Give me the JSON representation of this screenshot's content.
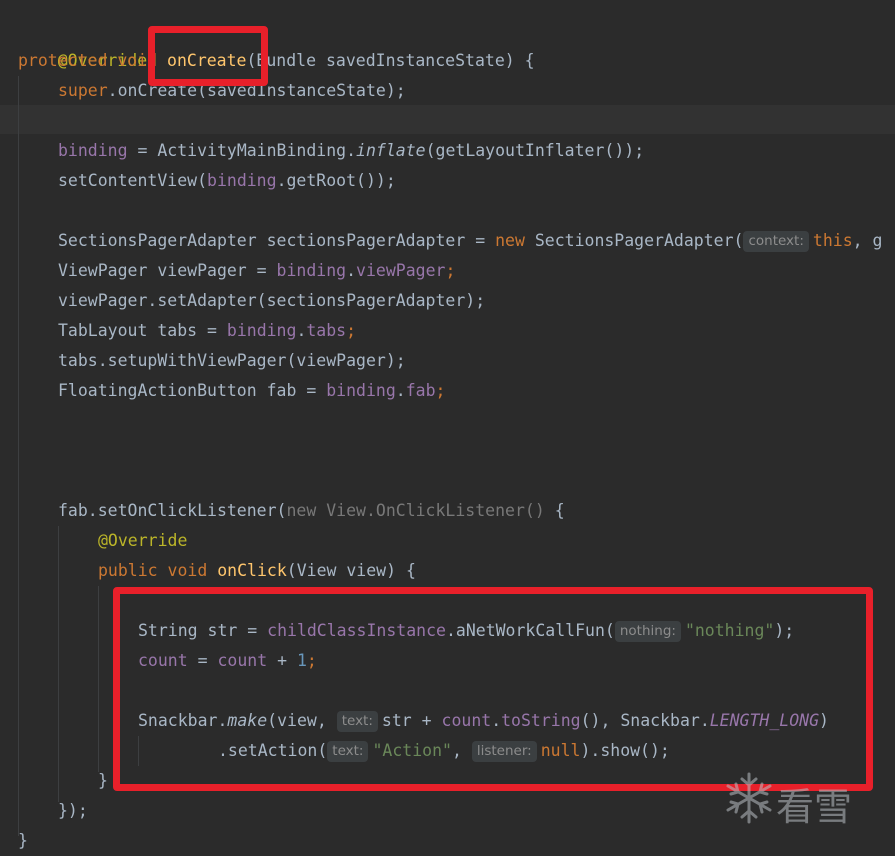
{
  "code": {
    "l1": "@Override",
    "l2_kw": "protected void ",
    "l2_fn": "onCreate",
    "l2_rest": "(Bundle savedInstanceState) {",
    "l3_kw": "super",
    "l3_rest": ".onCreate(savedInstanceState);",
    "l4_fld": "binding",
    "l4_mid": " = ActivityMainBinding.",
    "l4_it": "inflate",
    "l4_rest": "(getLayoutInflater());",
    "l5_a": "setContentView(",
    "l5_fld": "binding",
    "l5_rest": ".getRoot());",
    "l6_a": "SectionsPagerAdapter sectionsPagerAdapter = ",
    "l6_kw": "new",
    "l6_b": " SectionsPagerAdapter(",
    "l6_hint": "context:",
    "l6_kw2": "this",
    "l6_c": ", g",
    "l7_a": "ViewPager viewPager = ",
    "l7_fld": "binding",
    "l7_dot": ".",
    "l7_fld2": "viewPager",
    "l7_end": ";",
    "l8": "viewPager.setAdapter(sectionsPagerAdapter);",
    "l9_a": "TabLayout tabs = ",
    "l9_fld": "binding",
    "l9_dot": ".",
    "l9_fld2": "tabs",
    "l9_end": ";",
    "l10": "tabs.setupWithViewPager(viewPager);",
    "l11_a": "FloatingActionButton fab = ",
    "l11_fld": "binding",
    "l11_dot": ".",
    "l11_fld2": "fab",
    "l11_end": ";",
    "l12_a": "fab.setOnClickListener(",
    "l12_dim": "new View.OnClickListener()",
    "l12_b": " {",
    "l13": "@Override",
    "l14_kw": "public void ",
    "l14_fn": "onClick",
    "l14_rest": "(View view) {",
    "l15_a": "String str = ",
    "l15_fld": "childClassInstance",
    "l15_b": ".aNetWorkCallFun(",
    "l15_hint": "nothing:",
    "l15_str": "\"nothing\"",
    "l15_c": ");",
    "l16_fld": "count",
    "l16_a": " = ",
    "l16_fld2": "count",
    "l16_b": " + ",
    "l16_num": "1",
    "l16_c": ";",
    "l17_a": "Snackbar.",
    "l17_it": "make",
    "l17_b": "(view,",
    "l17_hint": "text:",
    "l17_c": "str + ",
    "l17_fld": "count",
    "l17_d": ".",
    "l17_fld2": "toString",
    "l17_e": "(), Snackbar.",
    "l17_const": "LENGTH_LONG",
    "l17_f": ")",
    "l18_a": ".setAction(",
    "l18_hint": "text:",
    "l18_str": "\"Action\"",
    "l18_b": ",",
    "l18_hint2": "listener:",
    "l18_kw": "null",
    "l18_c": ").show();",
    "l19": "}",
    "l20": "});",
    "l21": "}"
  },
  "watermark": {
    "text": "看雪"
  },
  "colors": {
    "background": "#2b2b2b",
    "keyword": "#cc7832",
    "annotation": "#bbb529",
    "method_decl": "#ffc66d",
    "field": "#9876aa",
    "string": "#6a8759",
    "number": "#6897bb",
    "highlight_box": "#e8202a"
  }
}
